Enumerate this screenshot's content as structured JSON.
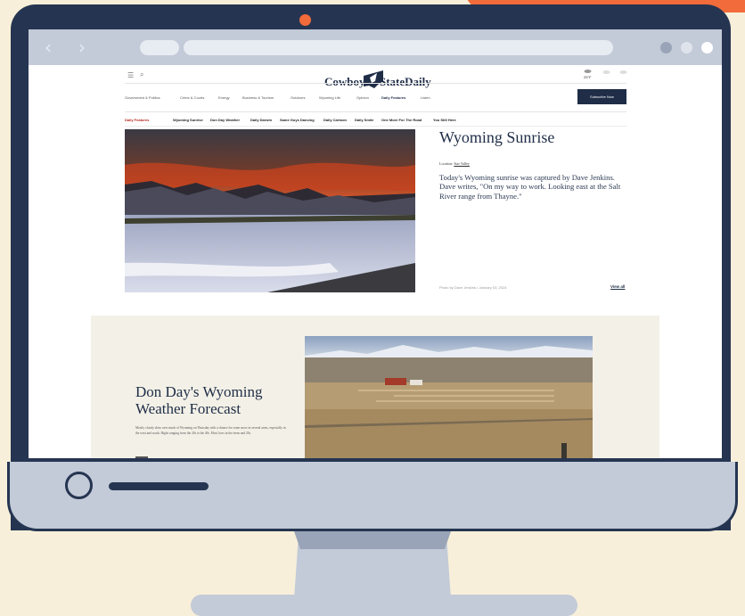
{
  "colors": {
    "accent": "#f26b3a",
    "frame": "#253551",
    "bezel": "#c3cad8",
    "background": "#f7efd9",
    "brand_navy": "#1f2d47",
    "daily_features_red": "#b52a1f"
  },
  "browser": {
    "back_icon": "chevron-left-icon",
    "forward_icon": "chevron-right-icon",
    "back_glyph": "‹",
    "forward_glyph": "›"
  },
  "site": {
    "hamburger_glyph": "☰",
    "search_glyph": "⌕",
    "logo_left": "Cowboy",
    "logo_right": "StateDaily",
    "weather_temp": "25°F",
    "nav": [
      "Government & Politics",
      "Crime & Courts",
      "Energy",
      "Business & Tourism",
      "Outdoors",
      "Wyoming Life",
      "Opinion",
      "Daily Features",
      "Listen"
    ],
    "subscribe": "Subscribe Now",
    "subnav": [
      "Daily Features",
      "Wyoming Sunrise",
      "Don Day Weather",
      "Daily Darwin",
      "Same Guys Dancing",
      "Daily Cartoon",
      "Daily Smile",
      "One More For The Road",
      "You Still Here"
    ]
  },
  "hero": {
    "title": "Wyoming Sunrise",
    "location_label": "Location:",
    "location_value": "Star Valley",
    "description": "Today's Wyoming sunrise was captured by Dave Jenkins. Dave writes, \"On my way to work. Looking east at the Salt River range from Thayne.\"",
    "credit": "Photo by Dave Jenkins • January 03, 2024",
    "view_all": "View all"
  },
  "weather": {
    "title": "Don Day's Wyoming Weather Forecast",
    "description": "Mostly cloudy skies over much of Wyoming on Thursday with a chance for some snow in several areas, especially in the west and south.  Highs ranging from the 20s to the 40s.  Most lows in the teens and 20s."
  }
}
